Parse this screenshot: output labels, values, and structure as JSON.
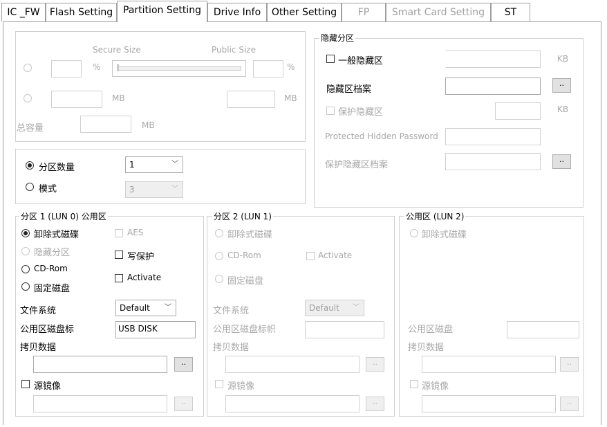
{
  "tabs": [
    {
      "label": "IC _FW",
      "state": "normal"
    },
    {
      "label": "Flash Setting",
      "state": "normal"
    },
    {
      "label": "Partition Setting",
      "state": "active"
    },
    {
      "label": "Drive Info",
      "state": "normal"
    },
    {
      "label": "Other Setting",
      "state": "normal"
    },
    {
      "label": "FP",
      "state": "disabled"
    },
    {
      "label": "Smart Card Setting",
      "state": "disabled"
    },
    {
      "label": "ST",
      "state": "normal"
    }
  ],
  "size_group": {
    "secure_size_label": "Secure Size",
    "public_size_label": "Public Size",
    "percent_unit_left": "%",
    "percent_unit_right": "%",
    "mb_unit_1": "MB",
    "mb_unit_2": "MB",
    "total_label": "总容量",
    "total_unit": "MB"
  },
  "partition_mode": {
    "count_label": "分区数量",
    "count_value": "1",
    "mode_label": "模式",
    "mode_value": "3"
  },
  "hidden_partition": {
    "legend": "隐藏分区",
    "general_label": "一般隐藏区",
    "general_unit": "KB",
    "file_label": "隐藏区档案",
    "protect_label": "保护隐藏区",
    "protect_unit": "KB",
    "password_label": "Protected Hidden Password",
    "protect_file_label": "保护隐藏区档案",
    "browse_label": ".."
  },
  "partition1": {
    "legend": "分区 1 (LUN 0) 公用区",
    "removable": "卸除式磁碟",
    "hidden": "隐藏分区",
    "cdrom": "CD-Rom",
    "fixed": "固定磁盘",
    "aes": "AES",
    "write_protect": "写保护",
    "activate": "Activate",
    "fs_label": "文件系统",
    "fs_value": "Default",
    "disk_label_label": "公用区磁盘标",
    "disk_label_value": "USB DISK",
    "copy_label": "拷贝数据",
    "mirror_label": "源镜像",
    "browse": ".."
  },
  "partition2": {
    "legend": "分区 2 (LUN 1)",
    "removable": "卸除式磁碟",
    "cdrom": "CD-Rom",
    "activate": "Activate",
    "fixed": "固定磁盘",
    "fs_label": "文件系统",
    "fs_value": "Default",
    "disk_label_label": "公用区磁盘标帜",
    "copy_label": "拷贝数据",
    "mirror_label": "源镜像",
    "browse": ".."
  },
  "partition3": {
    "legend": "公用区 (LUN 2)",
    "removable": "卸除式磁碟",
    "disk_label_label": "公用区磁盘",
    "copy_label": "拷贝数据",
    "mirror_label": "源镜像",
    "browse": ".."
  }
}
